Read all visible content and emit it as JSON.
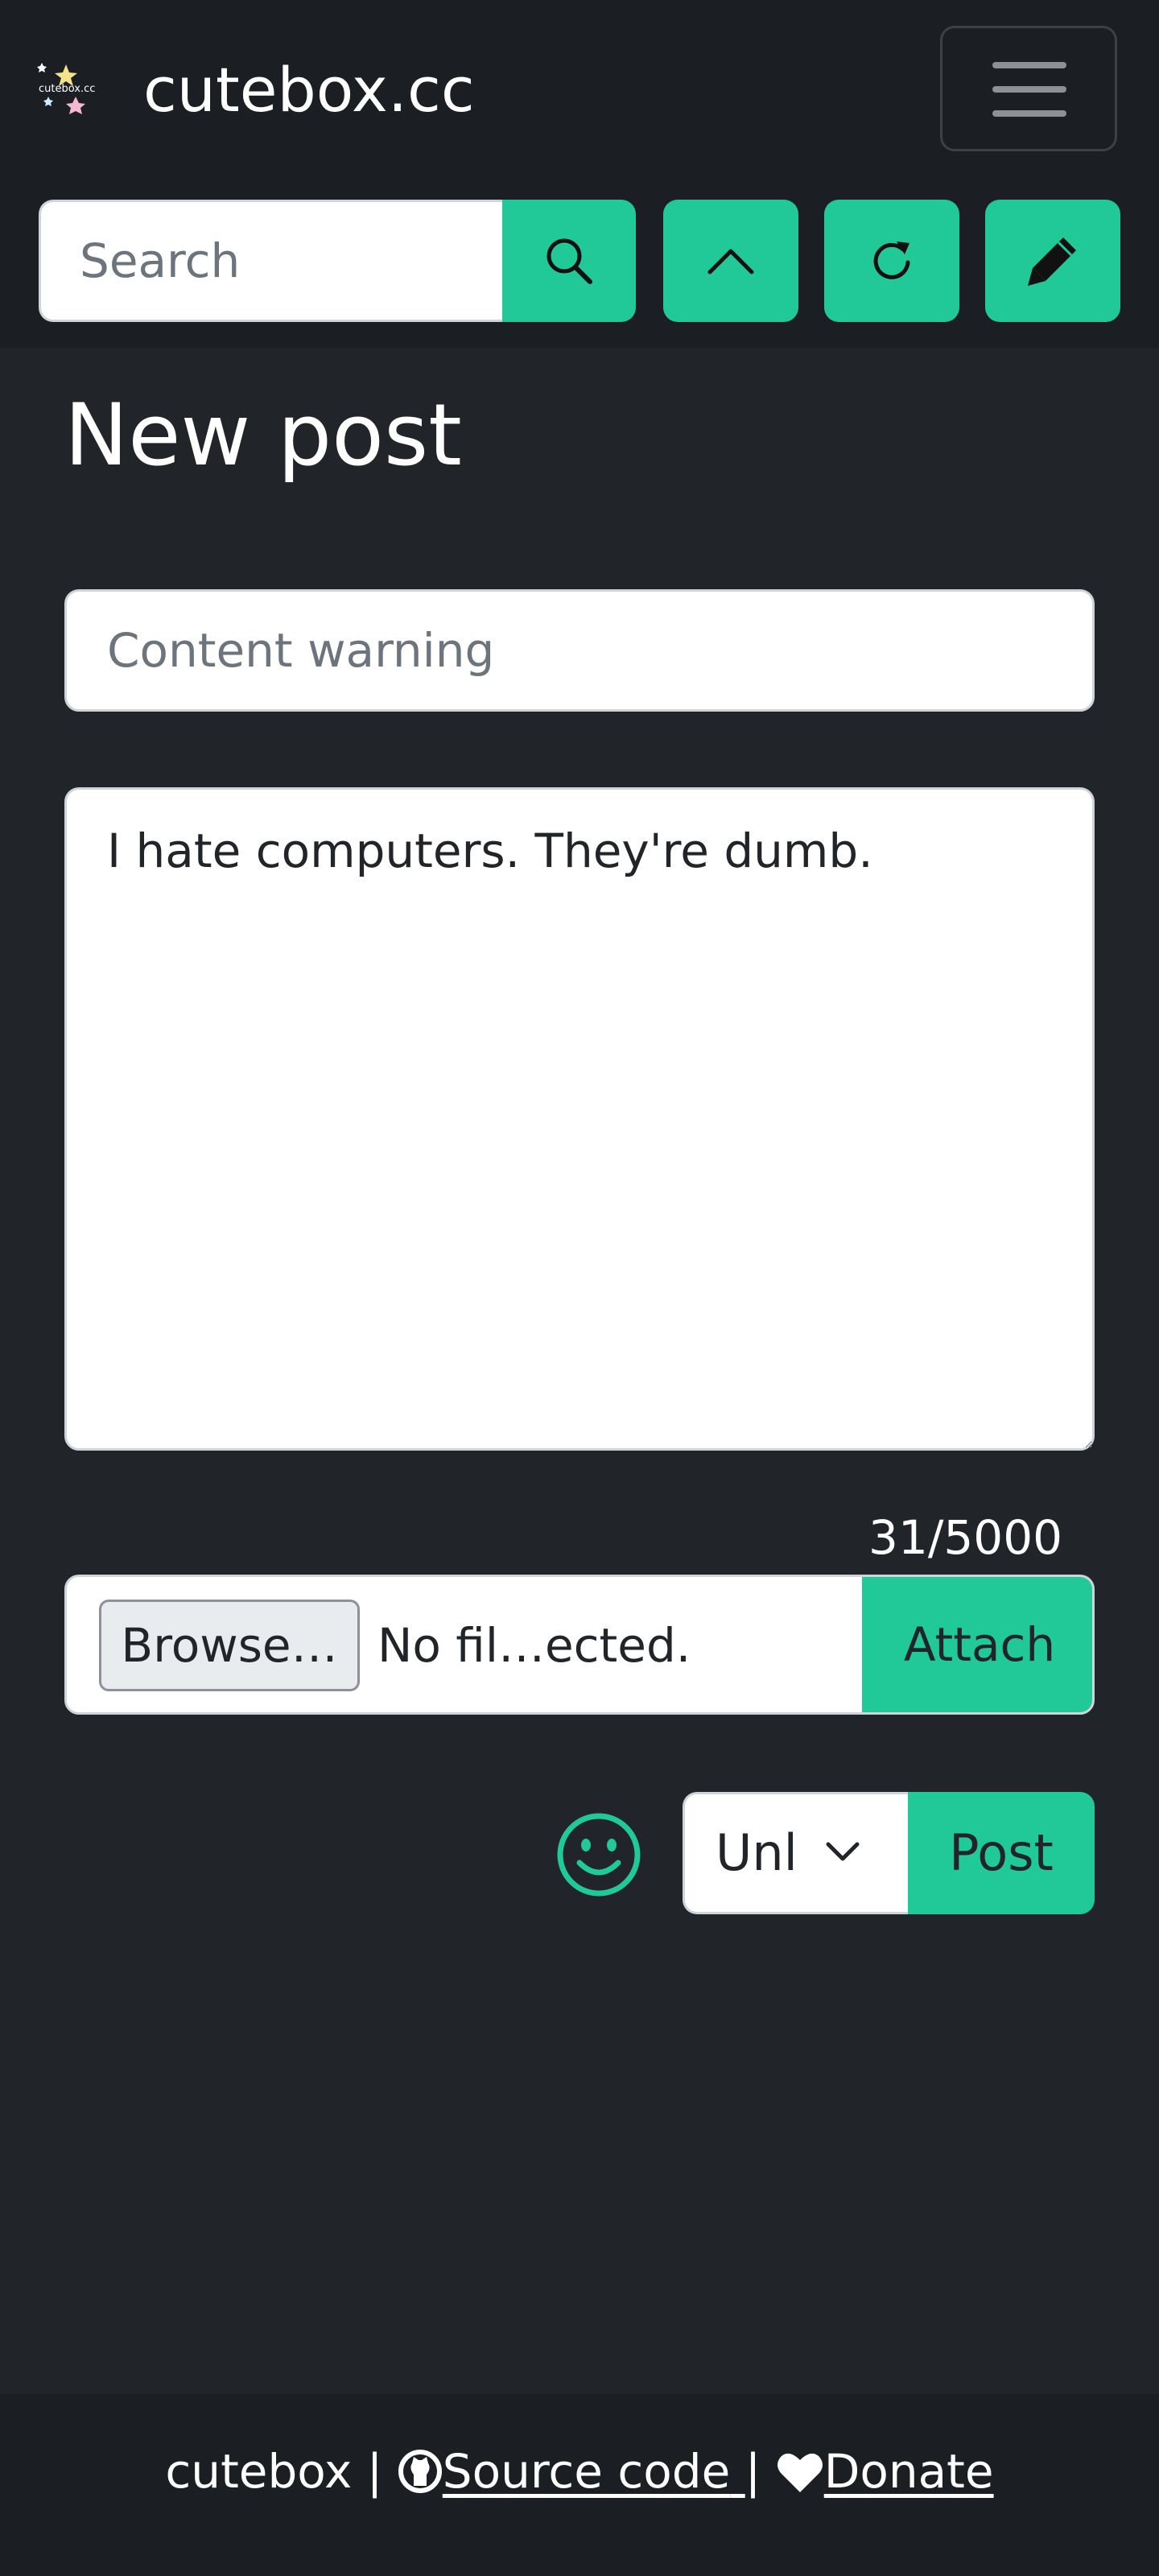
{
  "navbar": {
    "brand_name": "cutebox.cc",
    "logo_text": "cutebox.cc",
    "search_placeholder": "Search",
    "icons": {
      "search": "search-icon",
      "scroll_top": "chevron-up-icon",
      "refresh": "refresh-icon",
      "compose": "pencil-icon",
      "menu": "hamburger-icon"
    }
  },
  "main": {
    "title": "New post",
    "content_warning_placeholder": "Content warning",
    "post_text": "I hate computers. They're dumb.",
    "char_count": "31/5000",
    "file": {
      "browse_label": "Browse…",
      "status": "No fil…ected.",
      "attach_label": "Attach"
    },
    "visibility_value": "Unl",
    "post_label": "Post"
  },
  "footer": {
    "site": "cutebox",
    "separator": "|",
    "source_label": "Source code",
    "donate_label": "Donate"
  },
  "colors": {
    "accent": "#20c997",
    "background": "#212529",
    "navbar": "#1b1e22"
  }
}
